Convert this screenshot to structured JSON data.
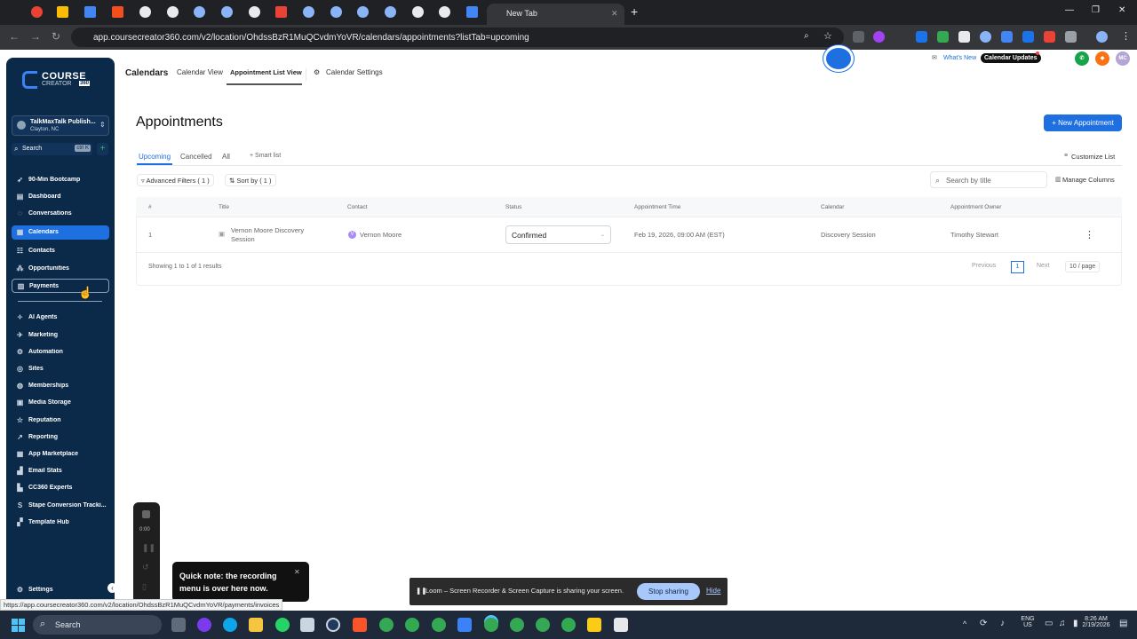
{
  "browser": {
    "active_tab_title": "New Tab",
    "url": "app.coursecreator360.com/v2/location/OhdssBzR1MuQCvdmYoVR/calendars/appointments?listTab=upcoming",
    "status_url": "https://app.coursecreator360.com/v2/location/OhdssBzR1MuQCvdmYoVR/payments/invoices"
  },
  "sidebar": {
    "logo_line1": "COURSE",
    "logo_line2": "CREATOR",
    "logo_badge": "360",
    "account_name": "TalkMaxTalk Publish...",
    "account_location": "Clayton, NC",
    "search_label": "Search",
    "search_shortcut": "ctrl K",
    "items": [
      {
        "label": "90-Min Bootcamp",
        "icon": "rocket-icon"
      },
      {
        "label": "Dashboard",
        "icon": "dashboard-icon"
      },
      {
        "label": "Conversations",
        "icon": "chat-icon"
      },
      {
        "label": "Calendars",
        "icon": "calendar-icon"
      },
      {
        "label": "Contacts",
        "icon": "contacts-icon"
      },
      {
        "label": "Opportunities",
        "icon": "opportunities-icon"
      },
      {
        "label": "Payments",
        "icon": "payments-icon"
      },
      {
        "label": "AI Agents",
        "icon": "ai-icon"
      },
      {
        "label": "Marketing",
        "icon": "marketing-icon"
      },
      {
        "label": "Automation",
        "icon": "automation-icon"
      },
      {
        "label": "Sites",
        "icon": "sites-icon"
      },
      {
        "label": "Memberships",
        "icon": "memberships-icon"
      },
      {
        "label": "Media Storage",
        "icon": "media-icon"
      },
      {
        "label": "Reputation",
        "icon": "star-icon"
      },
      {
        "label": "Reporting",
        "icon": "reporting-icon"
      },
      {
        "label": "App Marketplace",
        "icon": "marketplace-icon"
      },
      {
        "label": "Email Stats",
        "icon": "email-icon"
      },
      {
        "label": "CC360 Experts",
        "icon": "experts-icon"
      },
      {
        "label": "Stape Conversion Tracki...",
        "icon": "stape-icon"
      },
      {
        "label": "Template Hub",
        "icon": "template-icon"
      }
    ],
    "settings_label": "Settings"
  },
  "header": {
    "section": "Calendars",
    "tabs": [
      "Calendar View",
      "Appointment List View"
    ],
    "settings_link": "Calendar Settings",
    "whats_new": "What's New",
    "updates_badge": "Calendar Updates",
    "user_initials": "MC"
  },
  "main": {
    "title": "Appointments",
    "new_button": "+ New Appointment",
    "tabs": [
      "Upcoming",
      "Cancelled",
      "All"
    ],
    "smart_list": "+ Smart list",
    "customize": "Customize List",
    "filters": "Advanced Filters ( 1 )",
    "sort": "Sort by ( 1 )",
    "search_placeholder": "Search by title",
    "manage_columns": "Manage Columns",
    "columns": [
      "#",
      "Title",
      "Contact",
      "Status",
      "Appointment Time",
      "Calendar",
      "Appointment Owner"
    ],
    "rows": [
      {
        "num": "1",
        "title_line1": "Vernon Moore Discovery",
        "title_line2": "Session",
        "contact_initial": "V",
        "contact": "Vernon Moore",
        "status": "Confirmed",
        "time": "Feb 19, 2026, 09:00 AM (EST)",
        "calendar": "Discovery Session",
        "owner": "Timothy Stewart"
      }
    ],
    "showing": "Showing 1 to 1 of 1 results",
    "pager_prev": "Previous",
    "pager_current": "1",
    "pager_next": "Next",
    "per_page": "10 / page"
  },
  "loom": {
    "timer": "0:00",
    "toast": "Quick note: the recording menu is over here now.",
    "share_message": "Loom – Screen Recorder & Screen Capture is sharing your screen.",
    "stop_label": "Stop sharing",
    "hide_label": "Hide"
  },
  "taskbar": {
    "search_label": "Search",
    "lang": "ENG",
    "region": "US",
    "time": "8:26 AM",
    "date": "2/19/2026"
  }
}
